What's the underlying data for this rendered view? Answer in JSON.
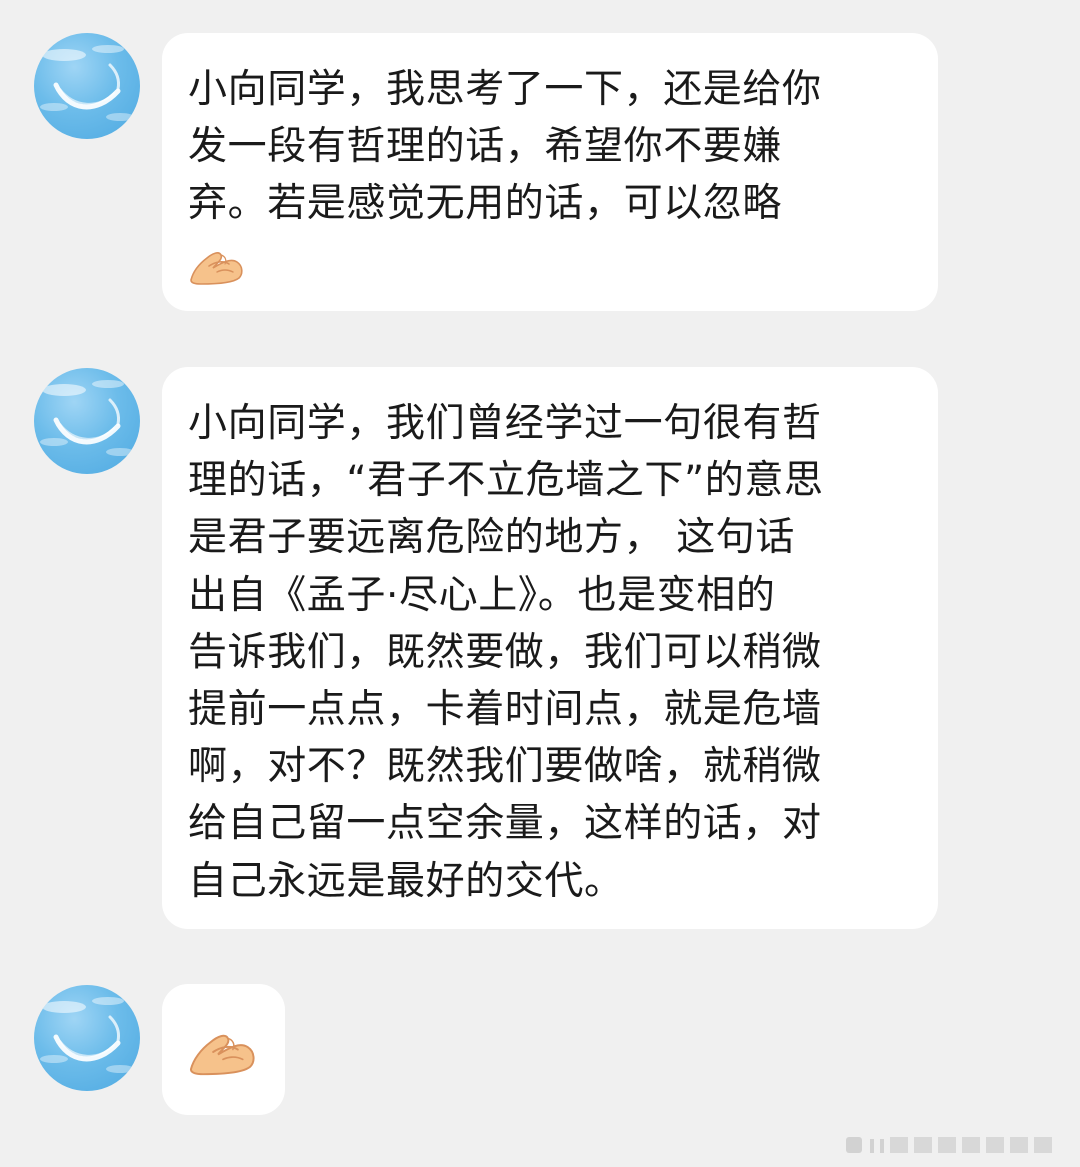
{
  "messages": [
    {
      "sender": "contact",
      "avatar_icon": "blue-sky-avatar-icon",
      "lines": [
        "小向同学，我思考了一下，还是给你",
        "发一段有哲理的话，希望你不要嫌",
        "弃。若是感觉无用的话，可以忽略"
      ],
      "trailing_emoji": "folded-hands-emoji-icon"
    },
    {
      "sender": "contact",
      "avatar_icon": "blue-sky-avatar-icon",
      "lines": [
        "小向同学，我们曾经学过一句很有哲",
        "理的话，“君子不立危墙之下”的意思",
        "是君子要远离危险的地方， 这句话",
        "出自《孟子·尽心上》。也是变相的",
        "告诉我们，既然要做，我们可以稍微",
        "提前一点点，卡着时间点，就是危墙",
        "啊，对不？既然我们要做啥，就稍微",
        "给自己留一点空余量，这样的话，对",
        "自己永远是最好的交代。"
      ]
    },
    {
      "sender": "contact",
      "avatar_icon": "blue-sky-avatar-icon",
      "emoji_only": "folded-hands-emoji-icon"
    }
  ],
  "colors": {
    "background": "#f0f0f0",
    "bubble": "#ffffff",
    "text": "#1a1a1a",
    "avatar": "#5aaee3",
    "emoji_skin": "#f6c28b"
  }
}
